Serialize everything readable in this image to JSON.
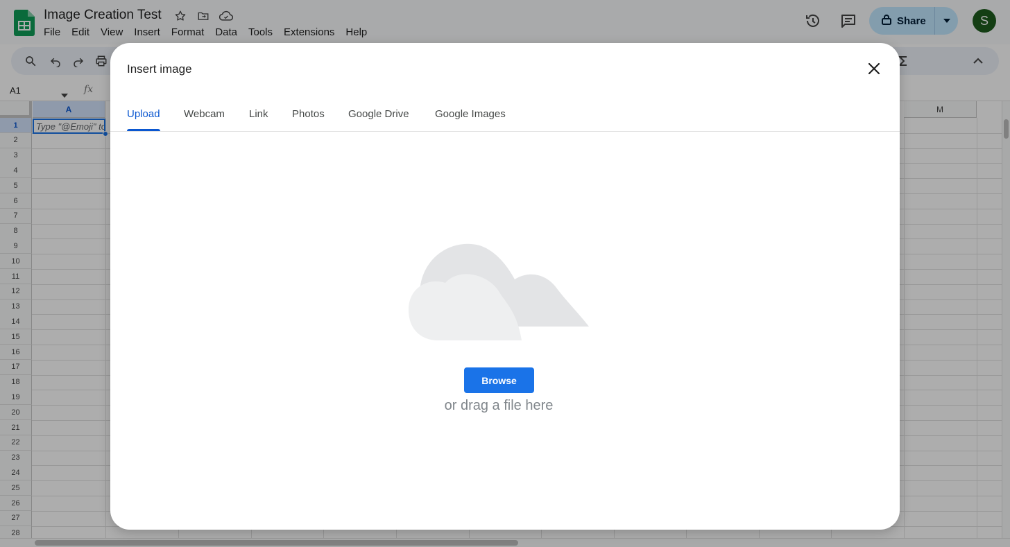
{
  "app": {
    "doc_title": "Image Creation Test",
    "menu": [
      "File",
      "Edit",
      "View",
      "Insert",
      "Format",
      "Data",
      "Tools",
      "Extensions",
      "Help"
    ],
    "share_label": "Share",
    "avatar_initial": "S",
    "name_box": "A1",
    "fx_label": "fx"
  },
  "grid": {
    "columns": [
      "A",
      "M"
    ],
    "rows": [
      "1",
      "2",
      "3",
      "4",
      "5",
      "6",
      "7",
      "8",
      "9",
      "10",
      "11",
      "12",
      "13",
      "14",
      "15",
      "16",
      "17",
      "18",
      "19",
      "20",
      "21",
      "22",
      "23",
      "24",
      "25",
      "26",
      "27",
      "28"
    ],
    "cell_a1_placeholder": "Type \"@Emoji\" to"
  },
  "dialog": {
    "title": "Insert image",
    "tabs": [
      "Upload",
      "Webcam",
      "Link",
      "Photos",
      "Google Drive",
      "Google Images"
    ],
    "active_tab": "Upload",
    "browse_label": "Browse",
    "drag_text": "or drag a file here"
  },
  "colors": {
    "accent": "#1a73e8",
    "active_tab": "#0b57d0",
    "share_bg": "#c2e7ff",
    "avatar_bg": "#1e5c1e",
    "sheets_green": "#0f9d58"
  }
}
